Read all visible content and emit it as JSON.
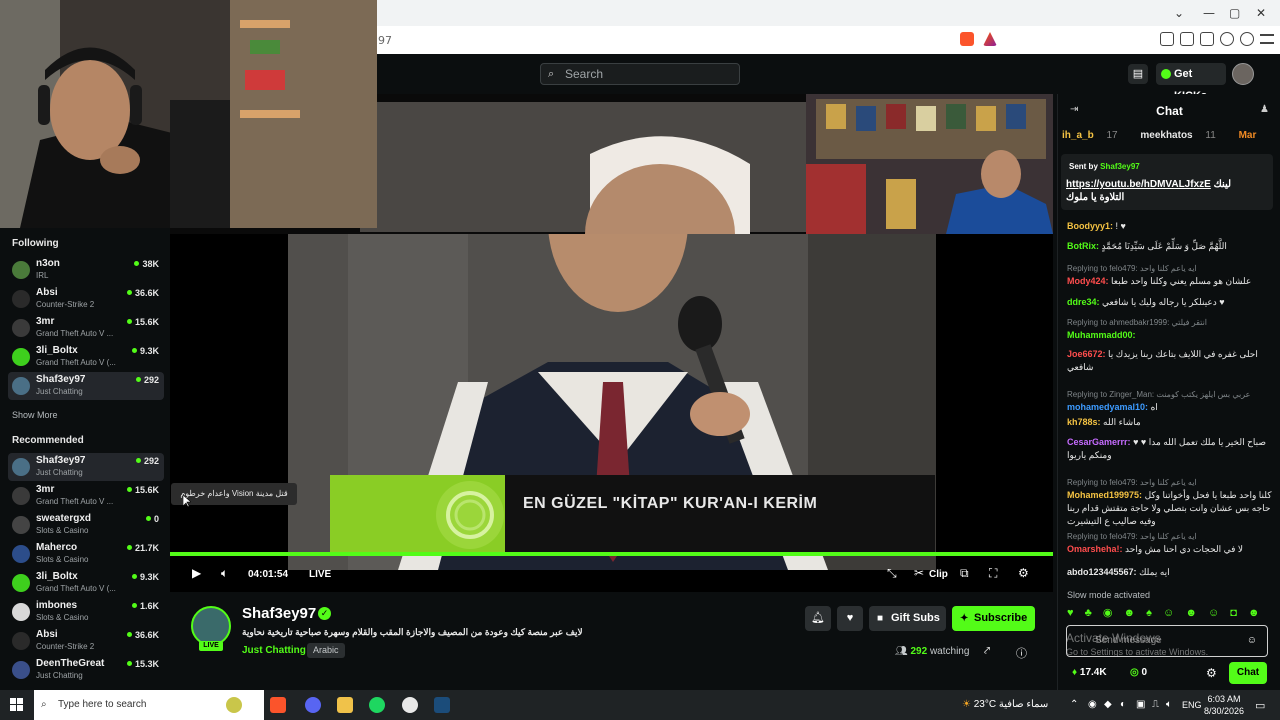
{
  "browser": {
    "url_fragment": "97",
    "window_controls": [
      "—",
      "▢",
      "✕",
      "⌄"
    ]
  },
  "topbar": {
    "search_placeholder": "Search",
    "get_kicks_label": "Get KICKs"
  },
  "sidebar": {
    "following_title": "Following",
    "following": [
      {
        "name": "n3on",
        "category": "IRL",
        "viewers": "38K",
        "color": "#4a7a3a"
      },
      {
        "name": "Absi",
        "category": "Counter-Strike 2",
        "viewers": "36.6K",
        "color": "#2a2a2a"
      },
      {
        "name": "3mr",
        "category": "Grand Theft Auto V ...",
        "viewers": "15.6K",
        "color": "#3a3a3a"
      },
      {
        "name": "3li_Boltx",
        "category": "Grand Theft Auto V (...",
        "viewers": "9.3K",
        "color": "#3ecf1d"
      },
      {
        "name": "Shaf3ey97",
        "category": "Just Chatting",
        "viewers": "292",
        "color": "#4a6f86"
      }
    ],
    "show_more": "Show More",
    "recommended_title": "Recommended",
    "recommended": [
      {
        "name": "Shaf3ey97",
        "category": "Just Chatting",
        "viewers": "292",
        "color": "#4a6f86"
      },
      {
        "name": "3mr",
        "category": "Grand Theft Auto V ...",
        "viewers": "15.6K",
        "color": "#3a3a3a"
      },
      {
        "name": "sweatergxd",
        "category": "Slots & Casino",
        "viewers": "0",
        "color": "#444"
      },
      {
        "name": "Maherco",
        "category": "Slots & Casino",
        "viewers": "21.7K",
        "color": "#2c4d8a"
      },
      {
        "name": "3li_Boltx",
        "category": "Grand Theft Auto V (...",
        "viewers": "9.3K",
        "color": "#3ecf1d"
      },
      {
        "name": "imbones",
        "category": "Slots & Casino",
        "viewers": "1.6K",
        "color": "#d8d8d8"
      },
      {
        "name": "Absi",
        "category": "Counter-Strike 2",
        "viewers": "36.6K",
        "color": "#2a2a2a"
      },
      {
        "name": "DeenTheGreat",
        "category": "Just Chatting",
        "viewers": "15.3K",
        "color": "#3a4f8a"
      }
    ]
  },
  "video": {
    "banner_text": "EN GÜZEL \"KİTAP\" KUR'AN-I KERİM",
    "tooltip": "واعدام خرطوم Vision قتل مدينة",
    "time": "04:01:54",
    "live_label": "LIVE",
    "clip_label": "Clip"
  },
  "channel": {
    "name": "Shaf3ey97",
    "live_badge": "LIVE",
    "stream_title": "لايف عبر منصة كيك وعودة من المصيف والاجازة المقب والقلام وسهرة صباحية تاريخية نحاوية",
    "category": "Just Chatting",
    "language": "Arabic",
    "gift_subs_label": "Gift Subs",
    "subscribe_label": "Subscribe",
    "watching_count": "292",
    "watching_label": "watching"
  },
  "chat": {
    "title": "Chat",
    "gifters": [
      {
        "name": "ih_a_b",
        "count": "17"
      },
      {
        "name": "meekhatos",
        "count": "11"
      },
      {
        "name": "Mar",
        "count": ""
      }
    ],
    "pinned_sent_by": "Sent by",
    "pinned_user": "Shaf3ey97",
    "pinned_link": "https://youtu.be/hDMVALJfxzE",
    "pinned_text": "لينك التلاوة يا ملوك",
    "messages": [
      {
        "reply": "",
        "user": "Boodyyy1:",
        "text": "! ♥",
        "color": "#f5c343"
      },
      {
        "reply": "",
        "user": "BotRix:",
        "text": "اللَّهُمَّ صَلِّ وَ سَلِّمْ عَلَى سَيِّدِنَا مُحَمَّدٍ",
        "color": "#53fc18"
      },
      {
        "reply": "Replying to felo479: ايه ياعم كلنا واحد",
        "user": "Mody424:",
        "text": "علشان هو مسلم يعني وكلنا واحد طبعا",
        "color": "#ff4d4d"
      },
      {
        "reply": "",
        "user": "ddre34:",
        "text": "دعينلكر يا رجاله وليك يا شافعي ♥",
        "color": "#53fc18"
      },
      {
        "reply": "Replying to ahmedbakr1999: انتقر فيلتي",
        "user": "Muhammadd00:",
        "text": "",
        "color": "#53fc18"
      },
      {
        "reply": "",
        "user": "Joe6672:",
        "text": "احلى غفره في اللايف بتاعك ربنا يزيدك يا شافعي",
        "color": "#ff4d4d"
      },
      {
        "reply": "Replying to Zinger_Man: عربي بس ايلهز يكتب كومنت",
        "user": "mohamedyamal10:",
        "text": "اه",
        "color": "#3d9bff"
      },
      {
        "reply": "",
        "user": "kh788s:",
        "text": "ماشاء الله",
        "color": "#f5c343"
      },
      {
        "reply": "",
        "user": "CesarGamerrr:",
        "text": "صباح الخير يا ملك تعمل الله مدا ♥ ♥ ومنكم ياريوا",
        "color": "#c66bff"
      },
      {
        "reply": "Replying to felo479: ايه ياعم كلنا واحد",
        "user": "Mohamed199975:",
        "text": "كلنا واحد طبعا يا فحل وأخواتنا وكل حاجه بس عشان وانت بتصلي ولا حاجة متقتش قدام ربنا وفيه صاليب ع التيشيرت",
        "color": "#f5c343"
      },
      {
        "reply": "Replying to felo479: ايه ياعم كلنا واحد",
        "user": "Omarsheha!:",
        "text": "لا في الحجات دي احنا مش واحد",
        "color": "#ff4d4d"
      },
      {
        "reply": "",
        "user": "abdo123445567:",
        "text": "ايه يملك",
        "color": "#e8e8e8"
      }
    ],
    "slow_mode": "Slow mode activated",
    "input_placeholder": "Send message",
    "activate_windows": "Activate Windows",
    "activate_windows_sub": "Go to Settings to activate Windows.",
    "kicks_balance": "17.4K",
    "kicks_other": "0",
    "chat_button": "Chat"
  },
  "taskbar": {
    "search_placeholder": "Type here to search",
    "temperature": "23°C",
    "weather_text": "سماء صافية",
    "language": "ENG",
    "time": "6:03 AM",
    "date": "8/30/2026"
  }
}
